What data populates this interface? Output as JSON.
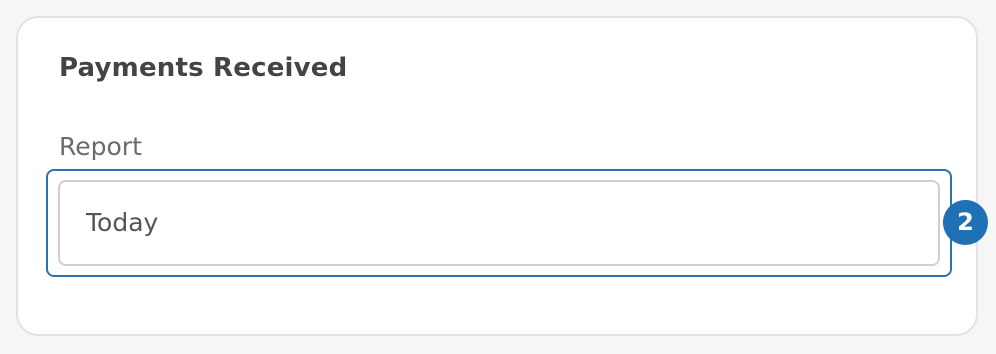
{
  "card": {
    "title": "Payments Received",
    "report_field": {
      "label": "Report",
      "selected_value": "Today"
    }
  },
  "annotation": {
    "step_number": "2",
    "highlight_color": "#2a73b0",
    "badge_color": "#1f70b4"
  }
}
